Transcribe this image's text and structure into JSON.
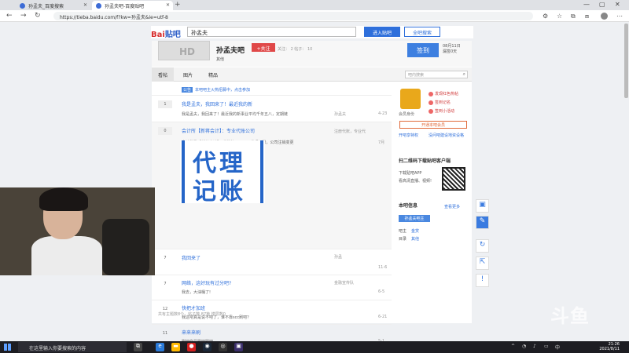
{
  "browser": {
    "tabs": [
      {
        "label": "孙孟夫_百度搜索",
        "active": false
      },
      {
        "label": "孙孟夫吧-百度贴吧",
        "active": true
      }
    ],
    "url": "https://tieba.baidu.com/f?kw=孙孟夫&ie=utf-8",
    "window_controls": [
      "—",
      "▢",
      "✕"
    ]
  },
  "search": {
    "logo_red": "Bai",
    "logo_blue": "贴吧",
    "query": "孙孟夫",
    "enter_label": "进入贴吧",
    "all_label": "全吧搜索"
  },
  "forum": {
    "name": "孙孟夫吧",
    "follow_label": "+关注",
    "stats": "关注： 2  帖子： 10",
    "category": "其他",
    "sign_label": "签到",
    "sign_date": "08月11日",
    "sign_sub": "漏签0天"
  },
  "page_tabs": [
    "看帖",
    "图片",
    "精品"
  ],
  "bar_search_placeholder": "吧内搜索",
  "notice": {
    "tag": "公告",
    "text": "本吧吧主火热招募中，点击参加"
  },
  "posts": [
    {
      "count": "1",
      "title": "我是孟夫，我回来了！最近我的新",
      "excerpt": "我是孟夫，我回来了！最近我的新事业平均千年五八，定期链",
      "author": "孙孟夫",
      "time": "4-23"
    },
    {
      "count": "0",
      "title": "会计所【新蒋会计】：专业代账公司",
      "excerpt": "会计所我【新蒋会计】，代账注册公司，代理记账，公司注销变更",
      "author": "注册代账，专业代",
      "time": "7月"
    },
    {
      "count": "7",
      "title": "我回来了",
      "excerpt": "",
      "author": "孙孟",
      "time": "11-6"
    },
    {
      "count": "7",
      "title": "网络，这好玩有过分吧?",
      "excerpt": "我去，大油桶了!",
      "author": "金融宣传队",
      "time": "6-5"
    },
    {
      "count": "12",
      "title": "快把才加班",
      "excerpt": "我这吧真是说不吧了，谁不靠scc刷吧？",
      "author": "",
      "time": "6-21"
    },
    {
      "count": "11",
      "title": "来来来刷",
      "excerpt": "刷吧你是刷吧刷吧",
      "author": "",
      "time": "5-1"
    }
  ],
  "ad": {
    "line1": "代理",
    "line2": "记账"
  },
  "footer": "共有主题数8个，帖子数 87篇  楼层数0",
  "right": {
    "medal_label": "会员身份",
    "links": [
      "发现红色热帖",
      "签到记名",
      "签到小活动"
    ],
    "join": "开通本吧会员",
    "small1": "开吧享特权",
    "small2": "没问吧建设地资设格",
    "download_title": "扫二维码下载贴吧客户端",
    "download_line1": "下载贴吧APP",
    "download_line2": "看高清直播、视频!",
    "barinfo_title": "本吧信息",
    "barinfo_more": "查看更多",
    "barinfo_btn": "孙孟夫吧主",
    "owner_label": "吧主",
    "owner_value": "金赏",
    "dir_label": "目录",
    "dir_value": "其他"
  },
  "side_buttons": [
    "▣",
    "✎",
    "↻",
    "⇱",
    "!"
  ],
  "watermark": "斗鱼",
  "taskbar": {
    "search_placeholder": "在这里输入你要搜索的内容",
    "time": "21:26",
    "date": "2021/8/11"
  },
  "colors": {
    "accent": "#2e6fdb",
    "follow": "#e04848",
    "medal": "#e9a81b"
  }
}
